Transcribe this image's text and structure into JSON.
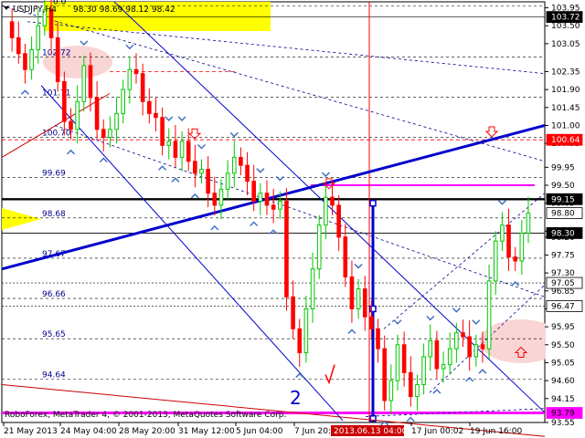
{
  "window": {
    "symbol_label": "USDJPY,H4",
    "ohlc_label": "98.30 98.69 98.12 98.42",
    "copyright": "RoboForex, MetaTrader 4, © 2001-2013, MetaQuotes Software Corp.",
    "wave_label": "2"
  },
  "chart_data": {
    "type": "candlestick",
    "title": "USDJPY,H4",
    "ylim": [
      93.55,
      104.1
    ],
    "y_ticks": [
      "103.95",
      "103.50",
      "103.05",
      "102.35",
      "101.90",
      "101.45",
      "101.00",
      "100.55",
      "99.95",
      "99.50",
      "99.05",
      "98.35",
      "98.20",
      "97.75",
      "97.30",
      "96.85",
      "96.40",
      "95.95",
      "95.50",
      "95.05",
      "94.60",
      "94.15",
      "93.55"
    ],
    "x_ticks": [
      "21 May 2013",
      "24 May 04:00",
      "28 May 20:00",
      "31 May 12:00",
      "5 Jun 04:00",
      "7 Jun 20:00",
      "13 Jun 00:00",
      "17 Jun 00:02",
      "19 Jun 16:00"
    ],
    "cursor_time_label": "2013.06.13 04:00",
    "price_labels": [
      {
        "value": 103.72,
        "text": "103.72",
        "style": "black"
      },
      {
        "value": 100.64,
        "text": "100.64",
        "style": "red"
      },
      {
        "value": 99.15,
        "text": "99.15",
        "style": "black"
      },
      {
        "value": 98.8,
        "text": "98.80",
        "style": "white"
      },
      {
        "value": 98.3,
        "text": "98.30",
        "style": "black"
      },
      {
        "value": 97.05,
        "text": "97.05",
        "style": "white"
      },
      {
        "value": 96.47,
        "text": "96.47",
        "style": "white"
      },
      {
        "value": 93.79,
        "text": "93.79",
        "style": "magenta"
      }
    ],
    "fib_levels": [
      {
        "value": 104.0,
        "text": "0.0"
      },
      {
        "value": 102.72,
        "text": "102.72"
      },
      {
        "value": 101.71,
        "text": "101.71"
      },
      {
        "value": 100.7,
        "text": "100.70"
      },
      {
        "value": 99.69,
        "text": "99.69"
      },
      {
        "value": 98.68,
        "text": "98.68"
      },
      {
        "value": 97.67,
        "text": "97.67"
      },
      {
        "value": 96.66,
        "text": "96.66"
      },
      {
        "value": 95.65,
        "text": "95.65"
      },
      {
        "value": 94.64,
        "text": "94.64"
      }
    ],
    "colors": {
      "bull": "#00c800",
      "bear": "#ff0000",
      "trend": "#0000cc",
      "magenta": "#ff00ff",
      "red_line": "#ff0000",
      "arrow": "#4472c4",
      "zone_pink": "#f9d5d5",
      "zone_yellow": "#ffff00"
    },
    "series_path": [
      103.6,
      103.2,
      102.8,
      102.4,
      102.9,
      103.5,
      103.9,
      103.2,
      102.1,
      101.1,
      100.9,
      101.6,
      102.5,
      101.7,
      100.9,
      100.7,
      100.9,
      101.3,
      101.9,
      102.4,
      102.3,
      101.6,
      101.3,
      101.2,
      100.5,
      100.6,
      100.2,
      100.6,
      100.1,
      99.8,
      99.9,
      99.3,
      99.0,
      99.4,
      99.8,
      100.2,
      100.0,
      99.6,
      99.1,
      99.3,
      99.0,
      98.9,
      99.1,
      96.7,
      95.9,
      95.3,
      96.4,
      97.4,
      98.5,
      99.2,
      99.0,
      98.2,
      97.2,
      96.4,
      96.9,
      96.2,
      95.9,
      95.4,
      94.1,
      94.6,
      95.5,
      94.8,
      94.2,
      94.5,
      95.2,
      95.6,
      94.9,
      95.0,
      95.4,
      95.8,
      95.7,
      95.2,
      95.5,
      95.4,
      97.1,
      98.1,
      98.5,
      97.7,
      97.6,
      98.3,
      98.8
    ]
  }
}
